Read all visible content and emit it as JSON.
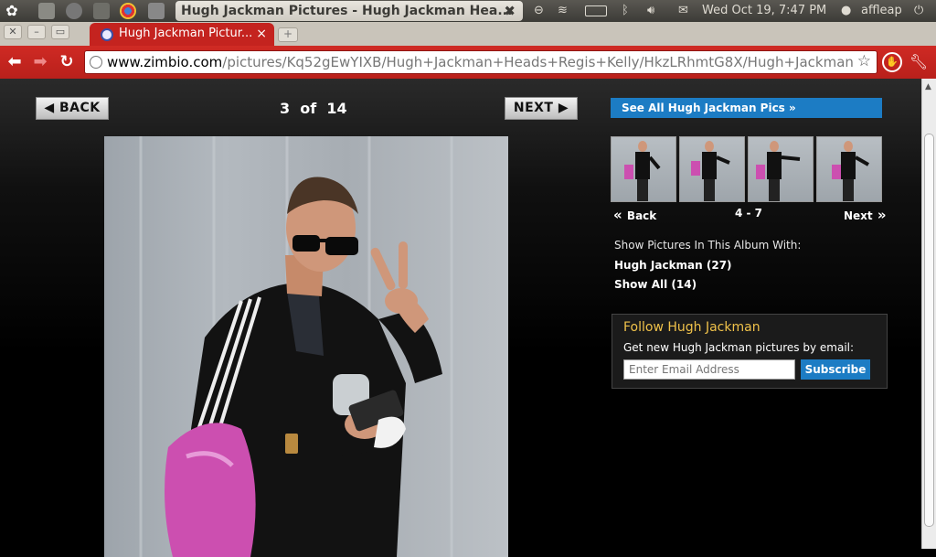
{
  "os_panel": {
    "window_title": "Hugh Jackman Pictures - Hugh Jackman Hea...",
    "title_close": "✖",
    "datetime": "Wed Oct 19,  7:47 PM",
    "user": "affleap"
  },
  "browser": {
    "tab_title": "Hugh Jackman Pictur...",
    "tab_close": "×",
    "new_tab": "+",
    "url_host": "www.zimbio.com",
    "url_path": "/pictures/Kq52gEwYIXB/Hugh+Jackman+Heads+Regis+Kelly/HkzLRhmtG8X/Hugh+Jackman",
    "accent_color": "#c4231f"
  },
  "pager": {
    "back_label": "BACK",
    "next_label": "NEXT",
    "current": "3",
    "of": "of",
    "total": "14"
  },
  "sidebar": {
    "see_all": "See All Hugh Jackman Pics »",
    "thumb_back": "Back",
    "thumb_range": "4 - 7",
    "thumb_next": "Next",
    "show_heading": "Show Pictures In This Album With:",
    "links": [
      {
        "label": "Hugh Jackman (27)"
      },
      {
        "label": "Show All (14)"
      }
    ]
  },
  "follow": {
    "title": "Follow Hugh Jackman",
    "description": "Get new Hugh Jackman pictures by email:",
    "email_placeholder": "Enter Email Address",
    "subscribe_label": "Subscribe"
  },
  "colors": {
    "link_blue": "#1c7cc4",
    "follow_title": "#f0c24a"
  }
}
